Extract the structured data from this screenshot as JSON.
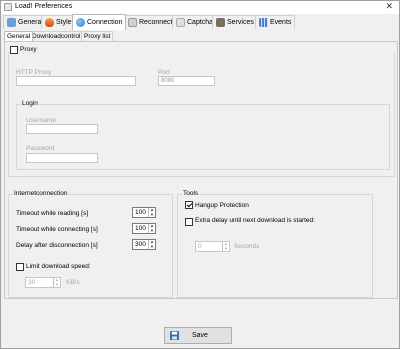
{
  "window": {
    "title": "Load! Preferences",
    "close_glyph": "✕"
  },
  "tabs": [
    {
      "label": "General",
      "icon": "general-icon",
      "color": "#6a9fd8"
    },
    {
      "label": "Style",
      "icon": "flame-icon",
      "color": "#e0582a"
    },
    {
      "label": "Connection",
      "icon": "globe-icon",
      "color": "#2f7fd0"
    },
    {
      "label": "Reconnect",
      "icon": "reconnect-icon",
      "color": "#b8b8b8"
    },
    {
      "label": "Captcha",
      "icon": "captcha-icon",
      "color": "#c0c0c0"
    },
    {
      "label": "Services",
      "icon": "services-icon",
      "color": "#7b6f5c"
    },
    {
      "label": "Events",
      "icon": "events-icon",
      "color": "#4f7fc4"
    }
  ],
  "subtabs": [
    "General",
    "Downloadcontrol",
    "Proxy list"
  ],
  "proxy": {
    "checkbox_label": "Proxy",
    "checked": false,
    "http_proxy_label": "HTTP Proxy",
    "http_proxy_value": "",
    "port_label": "Port",
    "port_value": "8080",
    "login_title": "Login",
    "username_label": "Username",
    "username_value": "",
    "password_label": "Password",
    "password_value": ""
  },
  "internet": {
    "title": "Internetconnection",
    "rows": [
      {
        "label": "Timeout while reading [s]",
        "value": "100"
      },
      {
        "label": "Timeout while connecting [s]",
        "value": "100"
      },
      {
        "label": "Delay after disconnection [s]",
        "value": "300"
      }
    ],
    "limit_label": "Limit download speed:",
    "limit_checked": false,
    "limit_value": "30",
    "limit_unit": "KB/s"
  },
  "tools": {
    "title": "Tools",
    "hangup_label": "Hangup Protection",
    "hangup_checked": true,
    "extra_delay_label": "Extra delay until next download is started:",
    "extra_delay_checked": false,
    "delay_value": "0",
    "delay_unit": "Seconds"
  },
  "save_label": "Save",
  "colors": {
    "accent": "#2f7fd0",
    "disabled_text": "#a8a8a8"
  }
}
